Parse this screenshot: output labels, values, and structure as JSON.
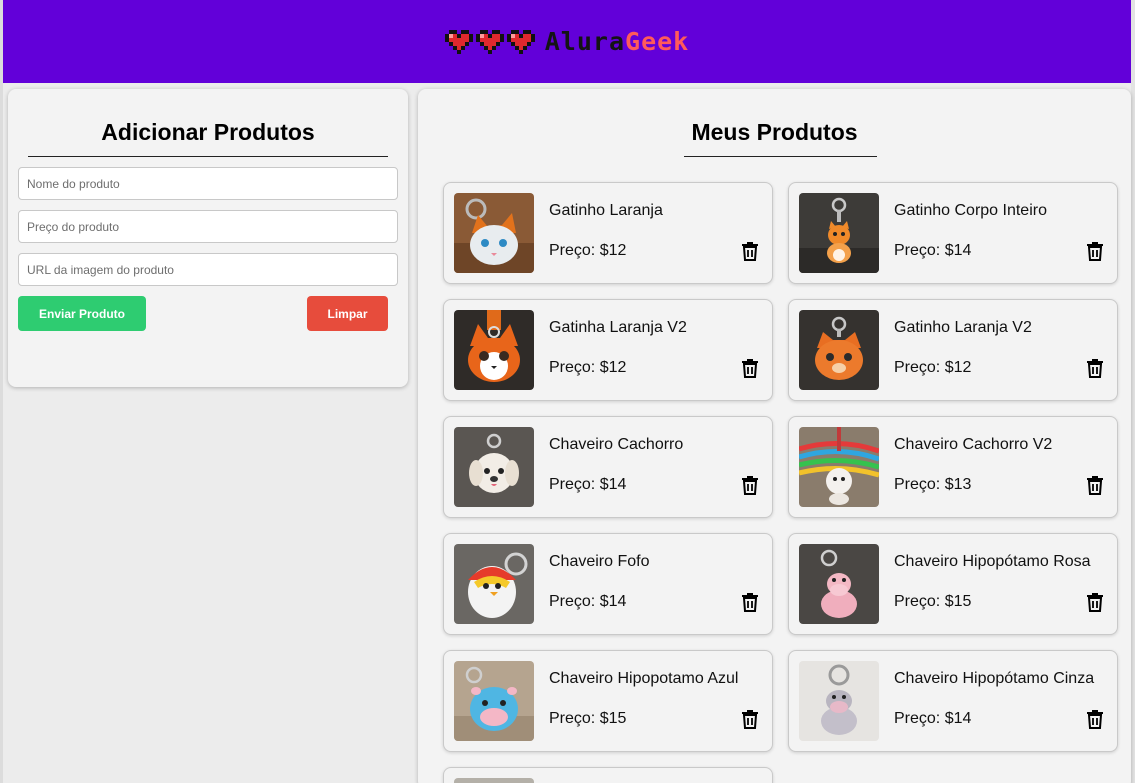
{
  "brand": {
    "part1": "Alura",
    "part2": "Geek",
    "hearts": 3,
    "header_color": "#6200d9",
    "accent_color": "#ff5a5a"
  },
  "add_panel": {
    "title": "Adicionar Produtos",
    "name_placeholder": "Nome do produto",
    "price_placeholder": "Preço do produto",
    "image_placeholder": "URL da imagem do produto",
    "send_label": "Enviar Produto",
    "clear_label": "Limpar",
    "send_color": "#2ecc71",
    "clear_color": "#e74c3c"
  },
  "list_panel": {
    "title": "Meus Produtos",
    "products": [
      {
        "name": "Gatinho Laranja",
        "price": "Preço: $12",
        "icon": "cat-orange-keychain"
      },
      {
        "name": "Gatinho Corpo Inteiro",
        "price": "Preço: $14",
        "icon": "cat-fullbody-keychain"
      },
      {
        "name": "Gatinha Laranja V2",
        "price": "Preço: $12",
        "icon": "cat-orange-v2-keychain"
      },
      {
        "name": "Gatinho Laranja V2",
        "price": "Preço: $12",
        "icon": "cat-orange-face-keychain"
      },
      {
        "name": "Chaveiro Cachorro",
        "price": "Preço: $14",
        "icon": "dog-keychain"
      },
      {
        "name": "Chaveiro Cachorro V2",
        "price": "Preço: $13",
        "icon": "dog-v2-keychain"
      },
      {
        "name": "Chaveiro Fofo",
        "price": "Preço: $14",
        "icon": "fluffy-keychain"
      },
      {
        "name": "Chaveiro Hipopótamo Rosa",
        "price": "Preço: $15",
        "icon": "hippo-pink-keychain"
      },
      {
        "name": "Chaveiro Hipopotamo Azul",
        "price": "Preço: $15",
        "icon": "hippo-blue-keychain"
      },
      {
        "name": "Chaveiro Hipopótamo Cinza",
        "price": "Preço: $14",
        "icon": "hippo-gray-keychain"
      }
    ]
  }
}
